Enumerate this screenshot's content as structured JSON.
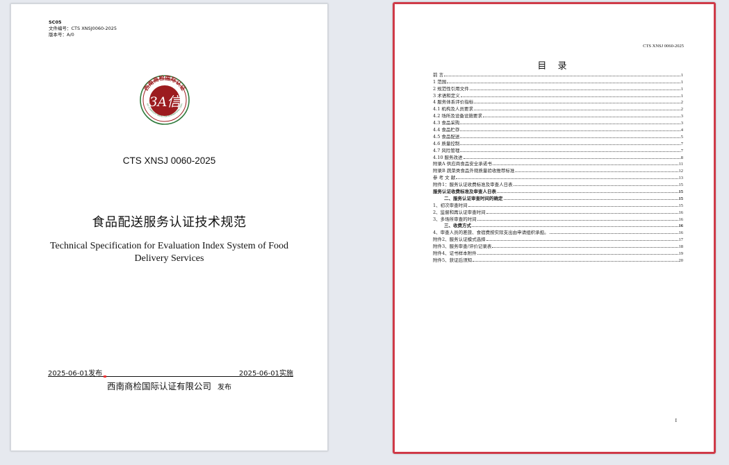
{
  "cover": {
    "doc_id": "SC05",
    "file_no": "文件编号：CTS XNSJ0060-2025",
    "version": "版本号：A/0",
    "logo": {
      "icon": "seal-logo-icon",
      "ring_text": "西南商检国际认证",
      "ring_text_en": "SOUTHWEST COMMODITY INSPECTION INTERNATIONAL CERTIFICATION",
      "center_text": "3A信",
      "color_primary": "#9c1c1f",
      "color_green": "#2f7a3b"
    },
    "standard_code": "CTS XNSJ 0060-2025",
    "title_cn": "食品配送服务认证技术规范",
    "title_en": "Technical Specification for Evaluation Index System of Food Delivery Services",
    "publish_date": "2025-06-01发布",
    "effective_date": "2025-06-01实施",
    "issuer_name": "西南商检国际认证有限公司",
    "issuer_verb": "发布"
  },
  "toc_page": {
    "header_code": "CTS XNSJ 0060-2025",
    "title": "目 录",
    "page_number": "I",
    "entries": [
      {
        "label": "前 言",
        "page": "1"
      },
      {
        "label": "1 范围",
        "page": "1"
      },
      {
        "label": "2 规范性引用文件",
        "page": "1"
      },
      {
        "label": "3 术语和定义",
        "page": "1"
      },
      {
        "label": "4 服务体系评价指标",
        "page": "2"
      },
      {
        "label": "4.1 机构及人员要求",
        "page": "2"
      },
      {
        "label": "4.2 场所及设备设施要求",
        "page": "3"
      },
      {
        "label": "4.3 食品采购",
        "page": "3"
      },
      {
        "label": "4.4 食品贮存",
        "page": "4"
      },
      {
        "label": "4.5 食品配送",
        "page": "5"
      },
      {
        "label": "4.6 质量控制",
        "page": "7"
      },
      {
        "label": "4.7 风险管理",
        "page": "7"
      },
      {
        "label": "4.10 服务改进",
        "page": "8"
      },
      {
        "label": "附录A 供应商食品安全承诺书",
        "page": "11"
      },
      {
        "label": "附录B 蔬菜类食品外观质量验收推荐标准",
        "page": "12"
      },
      {
        "label": "参 考 文 献",
        "page": "13"
      },
      {
        "label": "附件1：服务认证收费标准及审查人日表",
        "page": "15"
      },
      {
        "label": "服务认证收费标准及审查人日表",
        "page": "15",
        "bold": true
      },
      {
        "label": "二、服务认证审查时间的确定",
        "page": "15",
        "bold": true,
        "indent": true
      },
      {
        "label": "1、初次审查时间",
        "page": "15"
      },
      {
        "label": "2、监督和再认证审查时间",
        "page": "16"
      },
      {
        "label": "3、多场所审查的时间",
        "page": "16"
      },
      {
        "label": "三、收费方式",
        "page": "16",
        "bold": true,
        "indent": true
      },
      {
        "label": "4、审查人员的差旅、食宿费按实际支出由申请组织承担。",
        "page": "16"
      },
      {
        "label": "附件2、服务认证模式选择",
        "page": "17"
      },
      {
        "label": "附件3、服务审查/评价记录表",
        "page": "18"
      },
      {
        "label": "附件4、证书样本附件",
        "page": "19"
      },
      {
        "label": "附件5、获证后须知",
        "page": "20"
      }
    ]
  },
  "colors": {
    "background": "#e6e9ef",
    "selected_page_border": "#cf3a48"
  }
}
